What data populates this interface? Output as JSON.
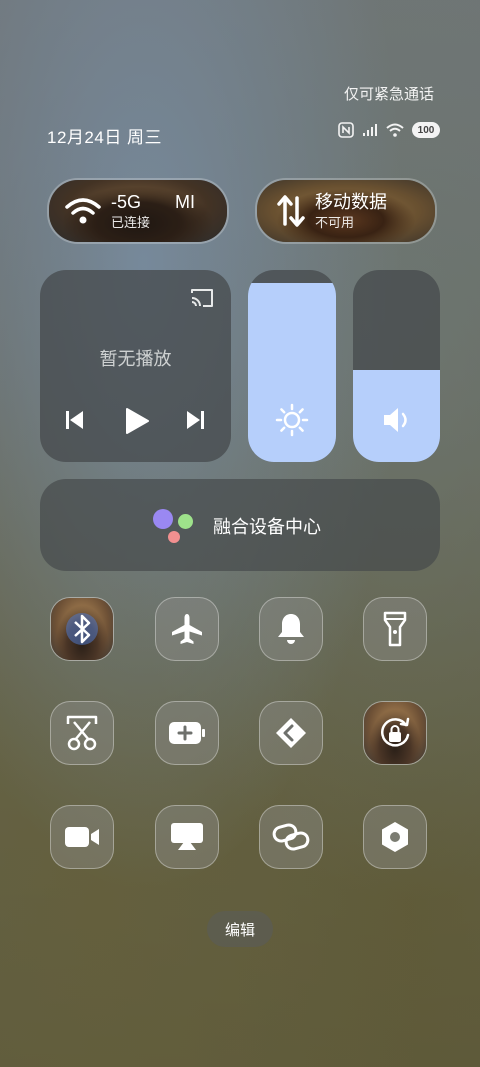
{
  "status": {
    "emergency_text": "仅可紧急通话",
    "date_text": "12月24日 周三",
    "battery_level": "100"
  },
  "connectivity": {
    "wifi": {
      "name": "-5G",
      "name_tail": "MI",
      "status": "已连接"
    },
    "mobile": {
      "title": "移动数据",
      "status": "不可用"
    }
  },
  "media": {
    "title": "暂无播放"
  },
  "sliders": {
    "brightness_level": 0.93,
    "volume_level": 0.48
  },
  "hub": {
    "label": "融合设备中心"
  },
  "edit": {
    "label": "编辑"
  },
  "colors": {
    "accent": "#b6cffb",
    "tile": "#464a4c"
  }
}
